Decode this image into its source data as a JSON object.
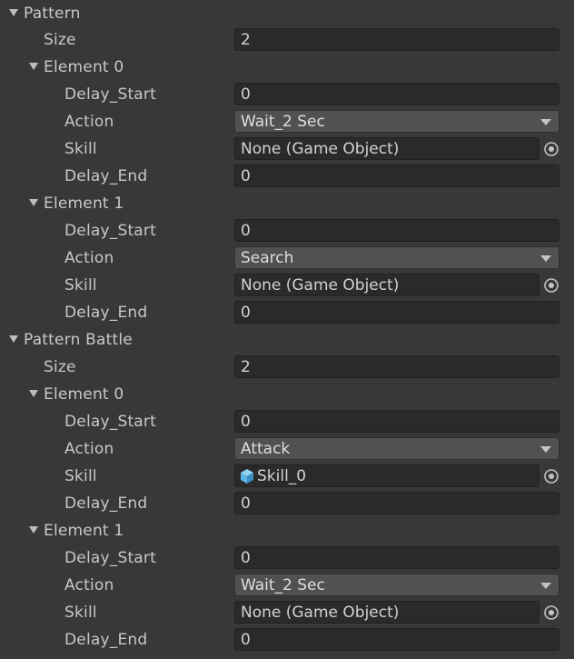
{
  "pattern": {
    "label": "Pattern",
    "size_label": "Size",
    "size_value": "2",
    "elements": [
      {
        "label": "Element 0",
        "delay_start_label": "Delay_Start",
        "delay_start_value": "0",
        "action_label": "Action",
        "action_value": "Wait_2 Sec",
        "skill_label": "Skill",
        "skill_value": "None (Game Object)",
        "delay_end_label": "Delay_End",
        "delay_end_value": "0"
      },
      {
        "label": "Element 1",
        "delay_start_label": "Delay_Start",
        "delay_start_value": "0",
        "action_label": "Action",
        "action_value": "Search",
        "skill_label": "Skill",
        "skill_value": "None (Game Object)",
        "delay_end_label": "Delay_End",
        "delay_end_value": "0"
      }
    ]
  },
  "pattern_battle": {
    "label": "Pattern Battle",
    "size_label": "Size",
    "size_value": "2",
    "elements": [
      {
        "label": "Element 0",
        "delay_start_label": "Delay_Start",
        "delay_start_value": "0",
        "action_label": "Action",
        "action_value": "Attack",
        "skill_label": "Skill",
        "skill_value": "Skill_0",
        "skill_icon": "prefab-cube-icon",
        "delay_end_label": "Delay_End",
        "delay_end_value": "0"
      },
      {
        "label": "Element 1",
        "delay_start_label": "Delay_Start",
        "delay_start_value": "0",
        "action_label": "Action",
        "action_value": "Wait_2 Sec",
        "skill_label": "Skill",
        "skill_value": "None (Game Object)",
        "delay_end_label": "Delay_End",
        "delay_end_value": "0"
      }
    ]
  },
  "colors": {
    "background": "#383838",
    "field_bg": "#2a2a2a",
    "dropdown_bg": "#515151",
    "text": "#c8c8c8",
    "prefab_icon": "#5ab4e6"
  }
}
